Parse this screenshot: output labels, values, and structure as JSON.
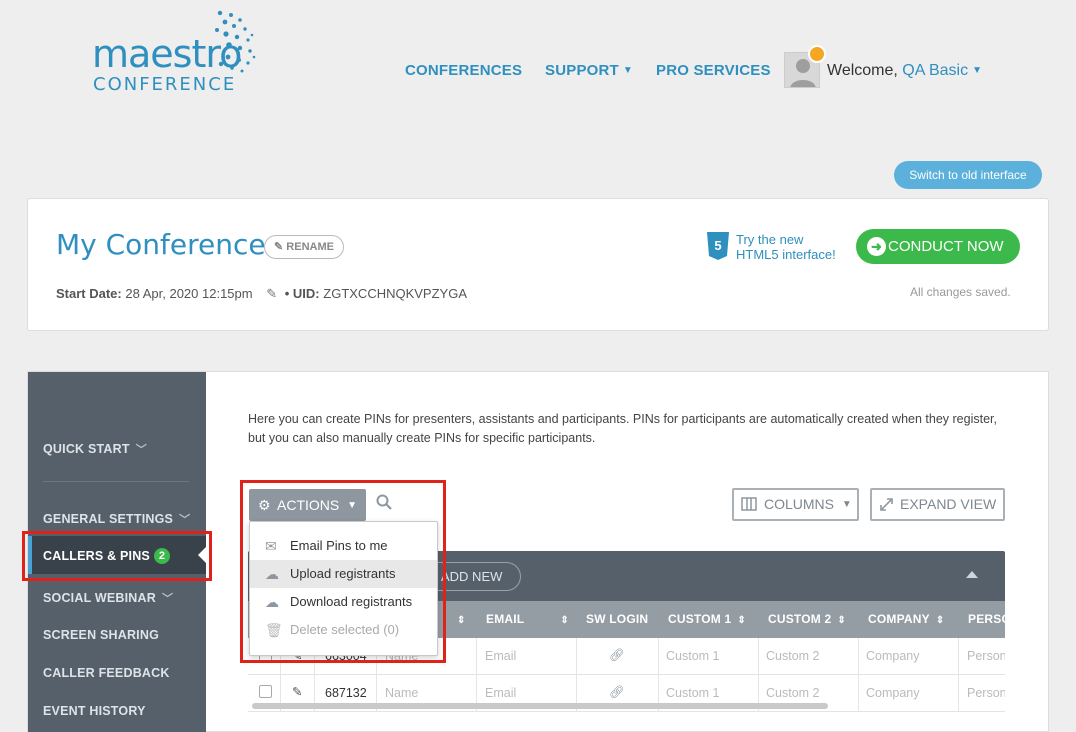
{
  "header": {
    "logo_word1": "maestro",
    "logo_word2": "CONFERENCE",
    "nav": [
      {
        "label": "CONFERENCES"
      },
      {
        "label": "SUPPORT"
      },
      {
        "label": "PRO SERVICES"
      }
    ],
    "welcome_prefix": "Welcome, ",
    "user_name": "QA Basic"
  },
  "switch_interface_label": "Switch to old interface",
  "conference": {
    "title": "My Conference",
    "rename_label": "RENAME",
    "start_date_label": "Start Date:",
    "start_date_value": "28 Apr, 2020 12:15pm",
    "uid_label": "• UID:",
    "uid_value": "ZGTXCCHNQKVPZYGA",
    "html5_line1": "Try the new",
    "html5_line2": "HTML5 interface!",
    "conduct_label": "CONDUCT NOW",
    "saved_status": "All changes saved."
  },
  "sidebar": {
    "items": [
      {
        "label": "QUICK START"
      },
      {
        "label": "GENERAL SETTINGS"
      },
      {
        "label": "CALLERS & PINS",
        "badge": "2"
      },
      {
        "label": "SOCIAL WEBINAR"
      },
      {
        "label": "SCREEN SHARING"
      },
      {
        "label": "CALLER FEEDBACK"
      },
      {
        "label": "EVENT HISTORY"
      }
    ]
  },
  "intro": "Here you can create PINs for presenters, assistants and participants. PINs for participants are automatically created when they register, but you can also manually create PINs for specific participants.",
  "toolbar": {
    "actions_label": "ACTIONS",
    "columns_label": "COLUMNS",
    "expand_label": "EXPAND VIEW",
    "add_new_label": "ADD NEW"
  },
  "actions_menu": [
    {
      "label": "Email Pins to me",
      "icon": "envelope-icon"
    },
    {
      "label": "Upload registrants",
      "icon": "cloud-upload-icon"
    },
    {
      "label": "Download registrants",
      "icon": "cloud-download-icon"
    },
    {
      "label": "Delete selected (0)",
      "icon": "trash-icon"
    }
  ],
  "table": {
    "columns": [
      "EMAIL",
      "SW LOGIN",
      "CUSTOM 1",
      "CUSTOM 2",
      "COMPANY",
      "PERSO"
    ],
    "rows": [
      {
        "pin": "663004",
        "name": "Name",
        "email": "Email",
        "custom1": "Custom 1",
        "custom2": "Custom 2",
        "company": "Company",
        "person": "Person"
      },
      {
        "pin": "687132",
        "name": "Name",
        "email": "Email",
        "custom1": "Custom 1",
        "custom2": "Custom 2",
        "company": "Company",
        "person": "Person"
      }
    ]
  },
  "colors": {
    "brand_blue": "#2f8fbf",
    "conduct_green": "#3cb94b",
    "sidebar_bg": "#56606a",
    "highlight_red": "#e0231a"
  }
}
